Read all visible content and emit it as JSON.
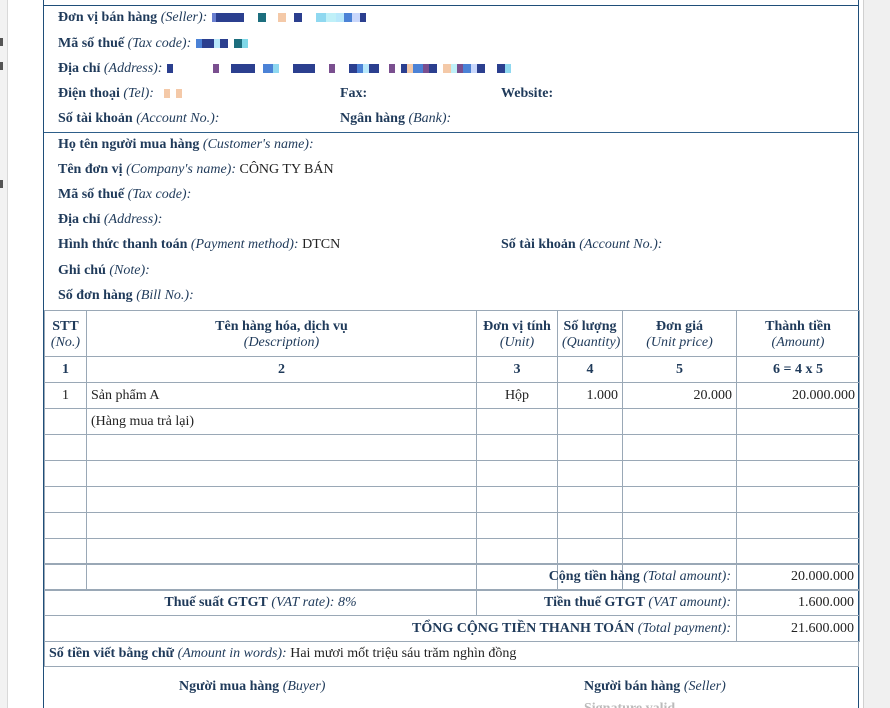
{
  "seller": {
    "name_label": "Đơn vị bán hàng",
    "name_label_en": "(Seller):",
    "tax_label": "Mã số thuế",
    "tax_label_en": "(Tax code):",
    "address_label": "Địa chỉ",
    "address_label_en": "(Address):",
    "phone_label": "Điện thoại",
    "phone_label_en": "(Tel):",
    "fax_label": "Fax:",
    "website_label": "Website:",
    "account_label": "Số tài khoản",
    "account_label_en": "(Account No.):",
    "bank_label": "Ngân hàng",
    "bank_label_en": "(Bank):"
  },
  "buyer": {
    "customer_label": "Họ tên người mua hàng",
    "customer_label_en": "(Customer's name):",
    "company_label": "Tên đơn vị",
    "company_label_en": "(Company's name):",
    "company_value": "CÔNG TY BÁN",
    "tax_label": "Mã số thuế",
    "tax_label_en": "(Tax code):",
    "address_label": "Địa chỉ",
    "address_label_en": "(Address):",
    "payment_label": "Hình thức thanh toán",
    "payment_label_en": "(Payment method):",
    "payment_value": "DTCN",
    "account_label": "Số tài khoản",
    "account_label_en": "(Account No.):",
    "note_label": "Ghi chú",
    "note_label_en": "(Note):",
    "bill_label": "Số đơn hàng",
    "bill_label_en": "(Bill No.):"
  },
  "table": {
    "headers": [
      {
        "vi": "STT",
        "en": "(No.)"
      },
      {
        "vi": "Tên hàng hóa, dịch vụ",
        "en": "(Description)"
      },
      {
        "vi": "Đơn vị tính",
        "en": "(Unit)"
      },
      {
        "vi": "Số lượng",
        "en": "(Quantity)"
      },
      {
        "vi": "Đơn giá",
        "en": "(Unit price)"
      },
      {
        "vi": "Thành tiền",
        "en": "(Amount)"
      }
    ],
    "numbers": [
      "1",
      "2",
      "3",
      "4",
      "5",
      "6 = 4 x 5"
    ],
    "rows": [
      {
        "no": "1",
        "desc": "Sản phẩm A",
        "unit": "Hộp",
        "qty": "1.000",
        "price": "20.000",
        "amount": "20.000.000"
      },
      {
        "no": "",
        "desc": "(Hàng mua trả lại)",
        "unit": "",
        "qty": "",
        "price": "",
        "amount": ""
      }
    ]
  },
  "totals": {
    "subtotal_label": "Cộng tiền hàng",
    "subtotal_label_en": "(Total amount):",
    "subtotal_value": "20.000.000",
    "vat_rate_label": "Thuế suất GTGT",
    "vat_rate_label_en": "(VAT rate):",
    "vat_rate_value": "8%",
    "vat_amount_label": "Tiền thuế GTGT",
    "vat_amount_label_en": "(VAT amount):",
    "vat_amount_value": "1.600.000",
    "grand_label": "TỔNG CỘNG TIỀN THANH TOÁN",
    "grand_label_en": "(Total payment):",
    "grand_value": "21.600.000"
  },
  "words": {
    "label": "Số tiền viết bằng chữ",
    "label_en": "(Amount in words):",
    "value": "Hai mươi mốt triệu sáu trăm nghìn đồng"
  },
  "signatures": {
    "buyer_label": "Người mua hàng",
    "buyer_label_en": "(Buyer)",
    "seller_label": "Người bán hàng",
    "seller_label_en": "(Seller)",
    "seller_cut_text": "Signature valid"
  },
  "colors": {
    "label_text": "#1f3a5a",
    "border": "#1f4e79",
    "grid": "#9aa8b6"
  }
}
